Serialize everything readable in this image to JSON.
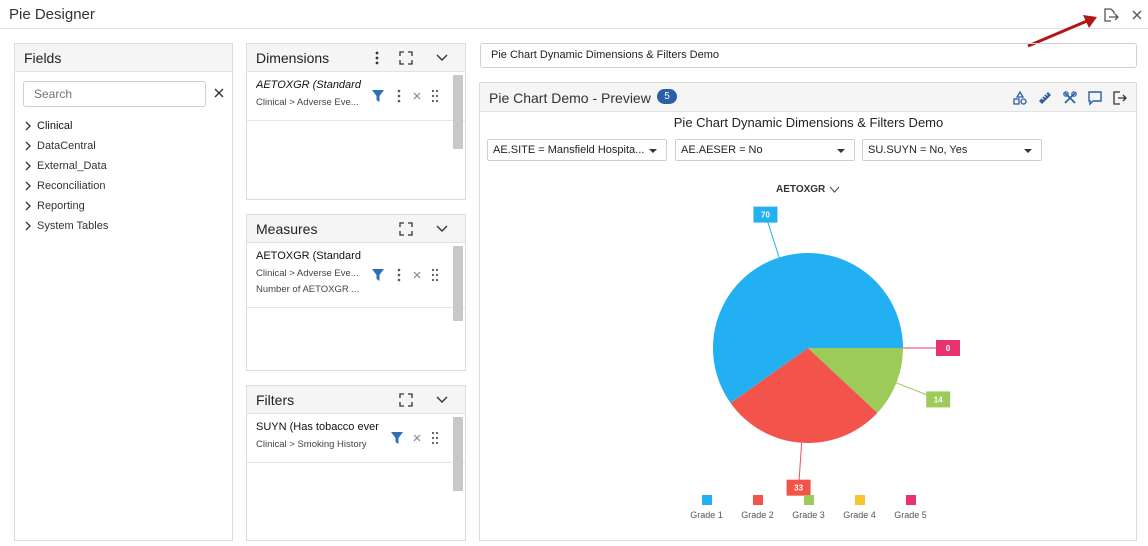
{
  "window": {
    "title": "Pie Designer"
  },
  "fields": {
    "title": "Fields",
    "search_placeholder": "Search",
    "items": [
      {
        "label": "Clinical"
      },
      {
        "label": "DataCentral"
      },
      {
        "label": "External_Data"
      },
      {
        "label": "Reconciliation"
      },
      {
        "label": "Reporting"
      },
      {
        "label": "System Tables"
      }
    ]
  },
  "dimensions": {
    "title": "Dimensions",
    "item": {
      "name": "AETOXGR (Standard T",
      "path": "Clinical > Adverse Eve..."
    }
  },
  "measures": {
    "title": "Measures",
    "item": {
      "name": "AETOXGR (Standard T",
      "path": "Clinical > Adverse Eve...",
      "agg": "Number of AETOXGR ..."
    }
  },
  "filters": {
    "title": "Filters",
    "item": {
      "name": "SUYN (Has tobacco ever b",
      "path": "Clinical > Smoking History"
    }
  },
  "chart_name": {
    "value": "Pie Chart Dynamic Dimensions & Filters Demo"
  },
  "preview": {
    "title": "Pie Chart Demo - Preview",
    "badge": "5",
    "chart_title": "Pie Chart Dynamic Dimensions & Filters Demo",
    "filter_selects": [
      {
        "value": "AE.SITE = Mansfield Hospita..."
      },
      {
        "value": "AE.AESER = No"
      },
      {
        "value": "SU.SUYN = No, Yes"
      }
    ],
    "dimension_selector": "AETOXGR"
  },
  "colors": {
    "accent": "#2b5ea7",
    "filter_icon": "#2f6fb5",
    "arrow": "#b01818"
  },
  "chart_data": {
    "type": "pie",
    "categories": [
      "Grade 1",
      "Grade 2",
      "Grade 3",
      "Grade 4",
      "Grade 5"
    ],
    "values": [
      70,
      33,
      14,
      0,
      0
    ],
    "value_labels": [
      "70",
      "33",
      "14",
      "",
      "0"
    ],
    "colors": [
      "#22b0f2",
      "#f2534a",
      "#9ccb5a",
      "#f7c52b",
      "#e8336e"
    ],
    "legend": "bottom"
  }
}
